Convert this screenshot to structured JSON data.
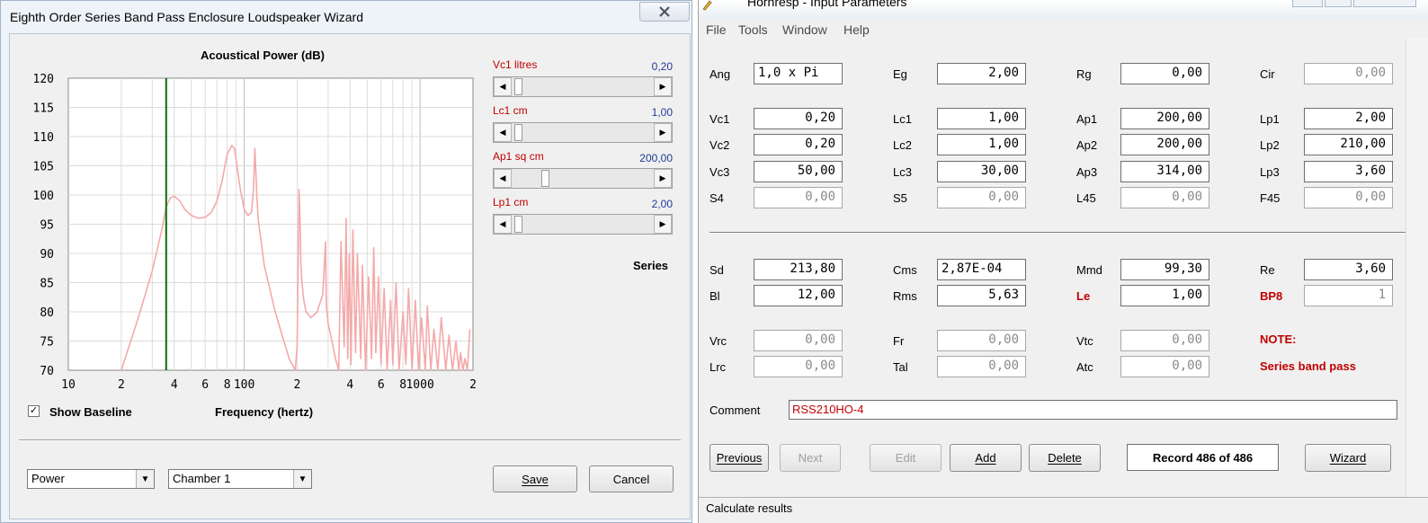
{
  "wizard": {
    "title": "Eighth Order Series Band Pass Enclosure Loudspeaker Wizard",
    "close_icon": "close-icon",
    "sliders": [
      {
        "label": "Vc1  litres",
        "value": "0,20",
        "position": 0.02
      },
      {
        "label": "Lc1  cm",
        "value": "1,00",
        "position": 0.02
      },
      {
        "label": "Ap1  sq cm",
        "value": "200,00",
        "position": 0.22
      },
      {
        "label": "Lp1  cm",
        "value": "2,00",
        "position": 0.02
      }
    ],
    "series_label": "Series",
    "show_baseline": {
      "label": "Show Baseline",
      "checked": true
    },
    "combo_output": "Power",
    "combo_chamber": "Chamber 1",
    "save_label": "Save",
    "cancel_label": "Cancel"
  },
  "chart_data": {
    "type": "line",
    "title": "Acoustical Power (dB)",
    "xlabel": "Frequency (hertz)",
    "ylabel": "",
    "x_scale": "log",
    "xlim": [
      10,
      2000
    ],
    "ylim": [
      70,
      120
    ],
    "y_ticks": [
      70,
      75,
      80,
      85,
      90,
      95,
      100,
      105,
      110,
      115,
      120
    ],
    "x_tick_labels": [
      {
        "value": 10,
        "label": "10"
      },
      {
        "value": 20,
        "label": "2"
      },
      {
        "value": 40,
        "label": "4"
      },
      {
        "value": 60,
        "label": "6"
      },
      {
        "value": 80,
        "label": "8"
      },
      {
        "value": 100,
        "label": "100"
      },
      {
        "value": 200,
        "label": "2"
      },
      {
        "value": 400,
        "label": "4"
      },
      {
        "value": 600,
        "label": "6"
      },
      {
        "value": 800,
        "label": "8"
      },
      {
        "value": 1000,
        "label": "1000"
      },
      {
        "value": 2000,
        "label": "2"
      }
    ],
    "grid": true,
    "marker_line_x": 36,
    "series": [
      {
        "color": "#f4a9a9",
        "x": [
          20,
          25,
          30,
          34,
          36,
          38,
          40,
          43,
          46,
          50,
          55,
          60,
          65,
          70,
          75,
          80,
          85,
          88,
          90,
          95,
          100,
          105,
          110,
          113,
          115,
          118,
          120,
          130,
          150,
          180,
          195,
          200,
          203,
          205,
          208,
          210,
          213,
          218,
          225,
          240,
          260,
          280,
          290,
          293,
          300,
          310,
          320,
          330,
          345,
          355,
          370,
          380,
          388,
          396,
          405,
          415,
          430,
          440,
          460,
          470,
          490,
          510,
          530,
          545,
          560,
          580,
          600,
          625,
          650,
          680,
          700,
          730,
          760,
          800,
          830,
          860,
          900,
          940,
          980,
          1020,
          1070,
          1100,
          1150,
          1200,
          1260,
          1320,
          1400,
          1460,
          1530,
          1600,
          1660,
          1700,
          1750,
          1800,
          1860,
          1920
        ],
        "y": [
          70,
          79,
          87,
          94,
          98,
          99.5,
          99.8,
          99,
          97.5,
          96.5,
          96,
          96.2,
          97,
          99,
          102.5,
          107,
          108.5,
          108,
          106,
          101,
          97.5,
          96.5,
          97,
          101,
          108,
          100,
          96,
          88,
          80,
          72,
          70,
          74,
          90,
          101,
          95,
          88,
          85,
          82,
          80,
          79,
          80,
          83,
          92,
          81,
          78,
          76,
          74,
          72,
          70,
          92,
          74,
          96,
          72,
          90,
          71,
          94,
          73,
          90,
          72,
          88,
          70,
          86,
          72,
          91,
          73,
          86,
          71,
          84,
          70,
          82,
          71,
          85,
          70,
          80,
          71,
          84,
          70,
          82,
          70,
          79,
          70,
          81,
          70,
          77,
          70,
          79,
          70,
          76,
          70,
          75,
          70,
          73,
          70,
          72,
          70,
          77
        ]
      }
    ]
  },
  "hornresp": {
    "title": "Hornresp - Input Parameters",
    "menu": [
      "File",
      "Tools",
      "Window",
      "Help"
    ],
    "fields": [
      {
        "label": "Ang",
        "value": "1,0 x Pi",
        "row": 0,
        "col": 0,
        "disabled": false
      },
      {
        "label": "Eg",
        "value": "2,00",
        "row": 0,
        "col": 1,
        "disabled": false
      },
      {
        "label": "Rg",
        "value": "0,00",
        "row": 0,
        "col": 2,
        "disabled": false
      },
      {
        "label": "Cir",
        "value": "0,00",
        "row": 0,
        "col": 3,
        "disabled": true
      },
      {
        "label": "Vc1",
        "value": "0,20",
        "row": 1,
        "col": 0,
        "disabled": false
      },
      {
        "label": "Lc1",
        "value": "1,00",
        "row": 1,
        "col": 1,
        "disabled": false
      },
      {
        "label": "Ap1",
        "value": "200,00",
        "row": 1,
        "col": 2,
        "disabled": false
      },
      {
        "label": "Lp1",
        "value": "2,00",
        "row": 1,
        "col": 3,
        "disabled": false
      },
      {
        "label": "Vc2",
        "value": "0,20",
        "row": 2,
        "col": 0,
        "disabled": false
      },
      {
        "label": "Lc2",
        "value": "1,00",
        "row": 2,
        "col": 1,
        "disabled": false
      },
      {
        "label": "Ap2",
        "value": "200,00",
        "row": 2,
        "col": 2,
        "disabled": false
      },
      {
        "label": "Lp2",
        "value": "210,00",
        "row": 2,
        "col": 3,
        "disabled": false
      },
      {
        "label": "Vc3",
        "value": "50,00",
        "row": 3,
        "col": 0,
        "disabled": false
      },
      {
        "label": "Lc3",
        "value": "30,00",
        "row": 3,
        "col": 1,
        "disabled": false
      },
      {
        "label": "Ap3",
        "value": "314,00",
        "row": 3,
        "col": 2,
        "disabled": false
      },
      {
        "label": "Lp3",
        "value": "3,60",
        "row": 3,
        "col": 3,
        "disabled": false
      },
      {
        "label": "S4",
        "value": "0,00",
        "row": 4,
        "col": 0,
        "disabled": true
      },
      {
        "label": "S5",
        "value": "0,00",
        "row": 4,
        "col": 1,
        "disabled": true
      },
      {
        "label": "L45",
        "value": "0,00",
        "row": 4,
        "col": 2,
        "disabled": true
      },
      {
        "label": "F45",
        "value": "0,00",
        "row": 4,
        "col": 3,
        "disabled": true
      },
      {
        "label": "Sd",
        "value": "213,80",
        "row": 5,
        "col": 0,
        "disabled": false
      },
      {
        "label": "Cms",
        "value": "2,87E-04",
        "row": 5,
        "col": 1,
        "disabled": false
      },
      {
        "label": "Mmd",
        "value": "99,30",
        "row": 5,
        "col": 2,
        "disabled": false
      },
      {
        "label": "Re",
        "value": "3,60",
        "row": 5,
        "col": 3,
        "disabled": false
      },
      {
        "label": "Bl",
        "value": "12,00",
        "row": 6,
        "col": 0,
        "disabled": false
      },
      {
        "label": "Rms",
        "value": "5,63",
        "row": 6,
        "col": 1,
        "disabled": false
      },
      {
        "label": "Le",
        "value": "1,00",
        "row": 6,
        "col": 2,
        "disabled": false,
        "red_label": true
      },
      {
        "label": "BP8",
        "value": "1",
        "row": 6,
        "col": 3,
        "disabled": true,
        "red_label": true
      },
      {
        "label": "Vrc",
        "value": "0,00",
        "row": 7,
        "col": 0,
        "disabled": true
      },
      {
        "label": "Fr",
        "value": "0,00",
        "row": 7,
        "col": 1,
        "disabled": true
      },
      {
        "label": "Vtc",
        "value": "0,00",
        "row": 7,
        "col": 2,
        "disabled": true
      },
      {
        "label": "Lrc",
        "value": "0,00",
        "row": 8,
        "col": 0,
        "disabled": true
      },
      {
        "label": "Tal",
        "value": "0,00",
        "row": 8,
        "col": 1,
        "disabled": true
      },
      {
        "label": "Atc",
        "value": "0,00",
        "row": 8,
        "col": 2,
        "disabled": true
      }
    ],
    "note_label": "NOTE:",
    "note_text": "Series band pass",
    "comment_label": "Comment",
    "comment_value": "RSS210HO-4",
    "buttons": {
      "previous": "Previous",
      "next": "Next",
      "edit": "Edit",
      "add": "Add",
      "delete": "Delete",
      "wizard": "Wizard"
    },
    "record": "Record 486 of 486",
    "status": "Calculate results"
  }
}
